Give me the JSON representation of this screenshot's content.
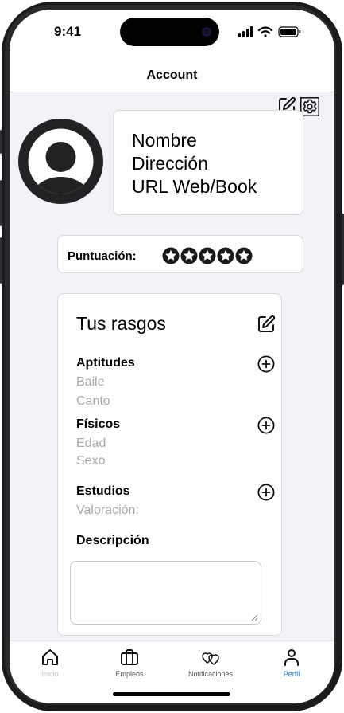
{
  "status_bar": {
    "time": "9:41"
  },
  "nav": {
    "title": "Account"
  },
  "profile": {
    "name": "Nombre",
    "address": "Dirección",
    "url": "URL Web/Book"
  },
  "rating": {
    "label": "Puntuación:",
    "stars": 5
  },
  "traits": {
    "title": "Tus rasgos",
    "sections": [
      {
        "title": "Aptitudes",
        "items": [
          "Baile",
          "Canto"
        ]
      },
      {
        "title": "Físicos",
        "items": [
          "Edad",
          "Sexo"
        ]
      },
      {
        "title": "Estudios",
        "items": [
          "Valoración:"
        ]
      }
    ],
    "description_label": "Descripción",
    "description_value": ""
  },
  "tabbar": {
    "tabs": [
      {
        "label": "Inicio",
        "icon": "home-icon"
      },
      {
        "label": "Empleos",
        "icon": "briefcase-icon"
      },
      {
        "label": "Notificaciones",
        "icon": "hearts-icon"
      },
      {
        "label": "Perfil",
        "icon": "person-icon",
        "active": true
      }
    ]
  },
  "colors": {
    "accent": "#1a7de0",
    "inactive_tab": "#c4c4c8",
    "muted_text": "#a8a8ae"
  }
}
